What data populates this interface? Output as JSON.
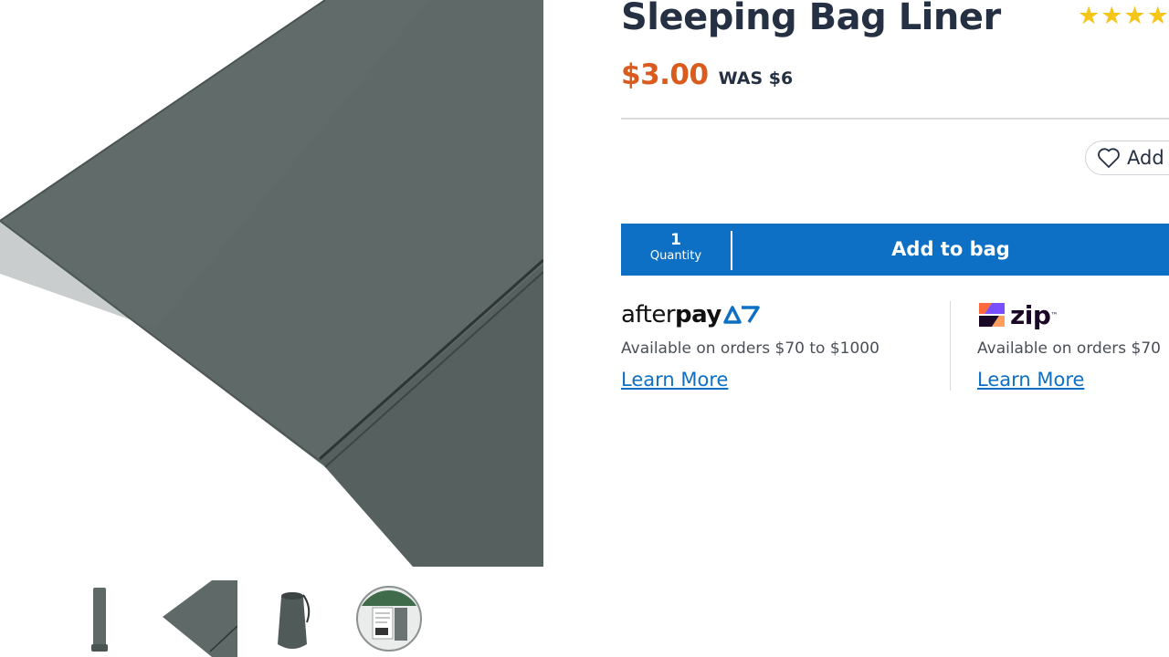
{
  "product": {
    "title": "Sleeping Bag Liner",
    "rating_stars": "★★★★",
    "price_now": "$3.00",
    "price_was": "WAS $6"
  },
  "images": {
    "main_icon": "sleeping-bag-liner-photo",
    "thumbnails": [
      "liner-rolled-thumb",
      "liner-corner-thumb",
      "liner-stuff-sack-thumb",
      "liner-packaging-thumb"
    ]
  },
  "wishlist": {
    "label": "Add",
    "icon": "heart-icon"
  },
  "bag": {
    "quantity_value": "1",
    "quantity_label": "Quantity",
    "add_label": "Add to bag"
  },
  "payments": {
    "afterpay": {
      "logo_light": "after",
      "logo_bold": "pay",
      "text": "Available on orders $70 to $1000",
      "link": "Learn More"
    },
    "zip": {
      "logo": "zip",
      "text": "Available on orders $70",
      "link": "Learn More"
    }
  },
  "colors": {
    "brand_blue": "#0d70c4",
    "price_orange": "#d95b1e",
    "title_navy": "#253043",
    "star_yellow": "#f5c518",
    "fabric_grey": "#5b6766"
  }
}
